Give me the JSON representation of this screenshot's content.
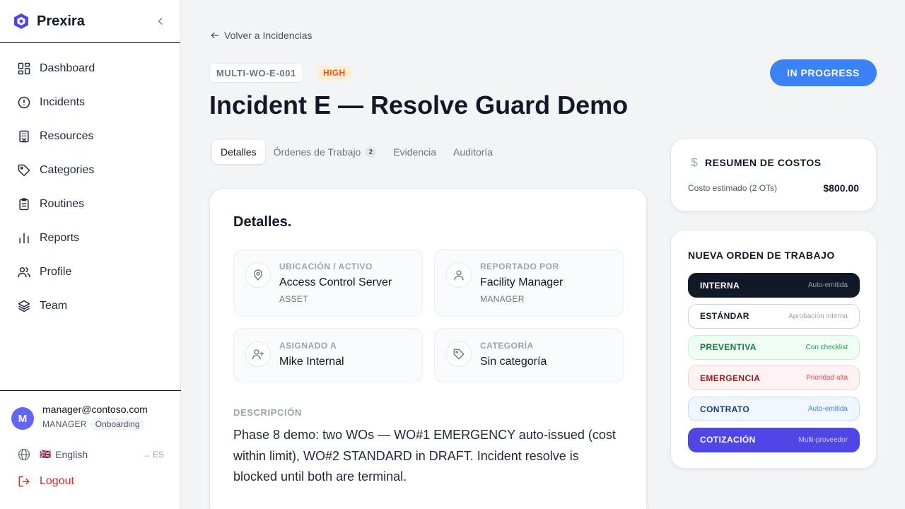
{
  "brand": {
    "name": "Prexira"
  },
  "sidebar": {
    "items": [
      {
        "label": "Dashboard",
        "icon": "dashboard-icon"
      },
      {
        "label": "Incidents",
        "icon": "alert-circle-icon"
      },
      {
        "label": "Resources",
        "icon": "building-icon"
      },
      {
        "label": "Categories",
        "icon": "tag-icon"
      },
      {
        "label": "Routines",
        "icon": "clipboard-icon"
      },
      {
        "label": "Reports",
        "icon": "bar-chart-icon"
      },
      {
        "label": "Profile",
        "icon": "users-icon"
      },
      {
        "label": "Team",
        "icon": "layers-icon"
      }
    ],
    "footer": {
      "avatar_letter": "M",
      "email": "manager@contoso.com",
      "role": "MANAGER",
      "badge": "Onboarding",
      "language_flag": "🇬🇧",
      "language": "English",
      "language_switch": "→ ES",
      "logout": "Logout"
    }
  },
  "header": {
    "back_label": "Volver a Incidencias",
    "code": "MULTI-WO-E-001",
    "priority": "HIGH",
    "status": "IN PROGRESS",
    "title": "Incident E — Resolve Guard Demo"
  },
  "tabs": [
    {
      "label": "Detalles",
      "active": true
    },
    {
      "label": "Órdenes de Trabajo",
      "count": "2"
    },
    {
      "label": "Evidencia"
    },
    {
      "label": "Auditoría"
    }
  ],
  "details": {
    "title": "Detalles.",
    "location": {
      "label": "UBICACIÓN / ACTIVO",
      "value": "Access Control Server",
      "sub": "ASSET"
    },
    "reporter": {
      "label": "REPORTADO POR",
      "value": "Facility Manager",
      "sub": "MANAGER"
    },
    "assignee": {
      "label": "ASIGNADO A",
      "value": "Mike Internal"
    },
    "category": {
      "label": "CATEGORÍA",
      "value": "Sin categoría"
    },
    "description_label": "DESCRIPCIÓN",
    "description": "Phase 8 demo: two WOs — WO#1 EMERGENCY auto-issued (cost within limit), WO#2 STANDARD in DRAFT. Incident resolve is blocked until both are terminal."
  },
  "costs": {
    "title": "RESUMEN DE COSTOS",
    "estimated_label": "Costo estimado (2 OTs)",
    "estimated_value": "$800.00"
  },
  "new_work_order": {
    "title": "NUEVA ORDEN DE TRABAJO",
    "types": [
      {
        "name": "INTERNA",
        "desc": "Auto-emitida"
      },
      {
        "name": "ESTÁNDAR",
        "desc": "Aprobación interna"
      },
      {
        "name": "PREVENTIVA",
        "desc": "Con checklist"
      },
      {
        "name": "EMERGENCIA",
        "desc": "Prioridad alta"
      },
      {
        "name": "CONTRATO",
        "desc": "Auto-emitida"
      },
      {
        "name": "COTIZACIÓN",
        "desc": "Multi-proveedor"
      }
    ]
  },
  "colors": {
    "accent": "#3b82f6",
    "avatar": "#6366f1",
    "priority_high_bg": "#ffedd5",
    "priority_high_text": "#ea580c",
    "logout": "#dc2626"
  }
}
